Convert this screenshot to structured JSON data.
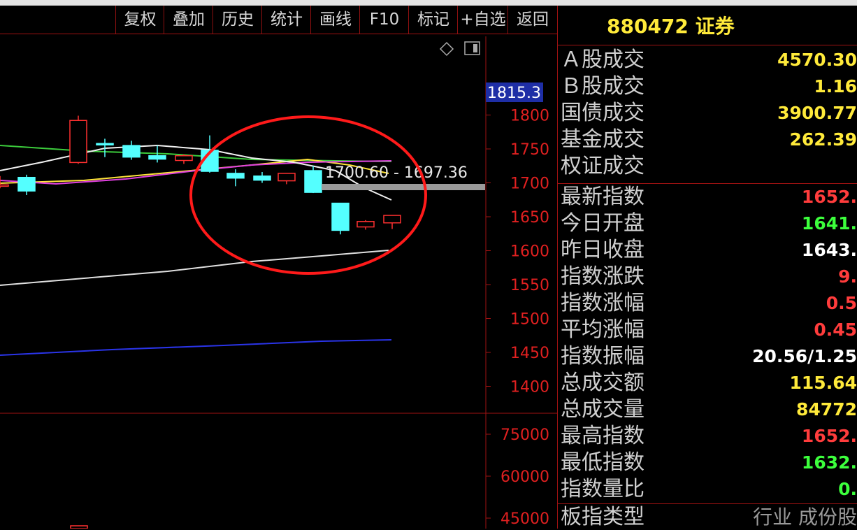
{
  "toolbar": {
    "buttons": [
      "复权",
      "叠加",
      "历史",
      "统计",
      "画线",
      "F10",
      "标记",
      "+自选",
      "返回"
    ]
  },
  "chart_data": {
    "type": "candlestick",
    "price_axis": {
      "ticks": [
        "1800",
        "1750",
        "1700",
        "1650",
        "1600",
        "1550",
        "1500",
        "1450",
        "1400"
      ],
      "range": [
        1390,
        1830
      ]
    },
    "volume_axis": {
      "ticks": [
        "75000",
        "60000",
        "45000"
      ]
    },
    "current_price_label": "1815.3",
    "gap_annotation": "1700.60 - 1697.36",
    "candles": [
      {
        "open": 1697,
        "high": 1710,
        "low": 1692,
        "close": 1697
      },
      {
        "open": 1708,
        "high": 1712,
        "low": 1682,
        "close": 1688
      },
      {
        "open": 1730,
        "high": 1799,
        "low": 1728,
        "close": 1792
      },
      {
        "open": 1758,
        "high": 1765,
        "low": 1738,
        "close": 1757
      },
      {
        "open": 1755,
        "high": 1762,
        "low": 1734,
        "close": 1738
      },
      {
        "open": 1740,
        "high": 1755,
        "low": 1730,
        "close": 1735
      },
      {
        "open": 1733,
        "high": 1742,
        "low": 1728,
        "close": 1740
      },
      {
        "open": 1748,
        "high": 1770,
        "low": 1715,
        "close": 1717
      },
      {
        "open": 1714,
        "high": 1720,
        "low": 1695,
        "close": 1707
      },
      {
        "open": 1710,
        "high": 1716,
        "low": 1700,
        "close": 1704
      },
      {
        "open": 1703,
        "high": 1713,
        "low": 1698,
        "close": 1714
      },
      {
        "open": 1718,
        "high": 1725,
        "low": 1685,
        "close": 1686
      },
      {
        "open": 1670,
        "high": 1670,
        "low": 1624,
        "close": 1630
      },
      {
        "open": 1635,
        "high": 1645,
        "low": 1631,
        "close": 1643
      },
      {
        "open": 1641,
        "high": 1652,
        "low": 1632,
        "close": 1652
      }
    ],
    "colors": {
      "up": "#ff3030",
      "down": "#54ffff"
    }
  },
  "panel": {
    "title": "880472 证券",
    "rows": [
      {
        "label": "Ａ股成交",
        "value": "4570.30",
        "color": "#ffea3a"
      },
      {
        "label": "Ｂ股成交",
        "value": "1.16",
        "color": "#ffea3a"
      },
      {
        "label": "国债成交",
        "value": "3900.77",
        "color": "#ffea3a"
      },
      {
        "label": "基金成交",
        "value": "262.39",
        "color": "#ffea3a"
      },
      {
        "label": "权证成交",
        "value": "",
        "color": "#ffea3a"
      },
      {
        "label": "最新指数",
        "value": "1652.",
        "color": "#ff3c3c"
      },
      {
        "label": "今日开盘",
        "value": "1641.",
        "color": "#3cff3c"
      },
      {
        "label": "昨日收盘",
        "value": "1643.",
        "color": "#ffffff"
      },
      {
        "label": "指数涨跌",
        "value": "9.",
        "color": "#ff3c3c"
      },
      {
        "label": "指数涨幅",
        "value": "0.5",
        "color": "#ff3c3c"
      },
      {
        "label": "平均涨幅",
        "value": "0.45",
        "color": "#ff3c3c"
      },
      {
        "label": "指数振幅",
        "value": "20.56/1.25",
        "color": "#ffffff"
      },
      {
        "label": "总成交额",
        "value": "115.64",
        "color": "#ffea3a"
      },
      {
        "label": "总成交量",
        "value": "84772",
        "color": "#ffea3a"
      },
      {
        "label": "最高指数",
        "value": "1652.",
        "color": "#ff3c3c"
      },
      {
        "label": "最低指数",
        "value": "1632.",
        "color": "#3cff3c"
      },
      {
        "label": "指数量比",
        "value": "0.",
        "color": "#3cff3c"
      },
      {
        "label": "板指类型",
        "value": "行业 成份股",
        "color": "#9a9a9a"
      }
    ]
  }
}
